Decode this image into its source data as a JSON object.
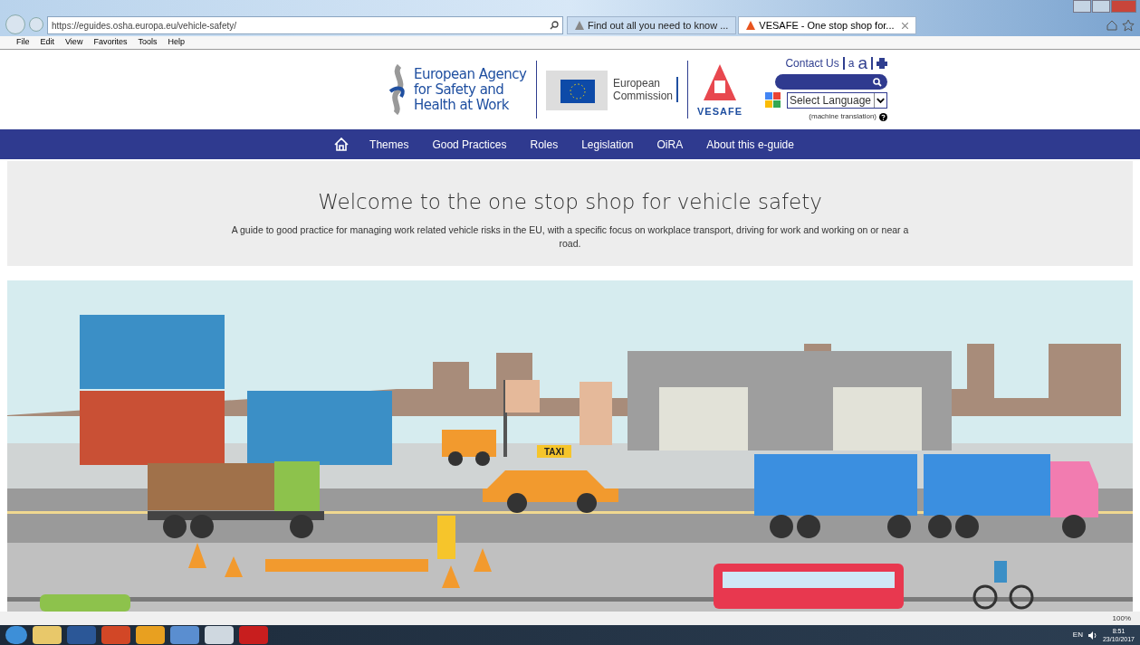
{
  "browser": {
    "url": "https://eguides.osha.europa.eu/vehicle-safety/",
    "tabs": [
      {
        "label": "Find out all you need to know ...",
        "selected": false
      },
      {
        "label": "VESAFE - One stop shop for...",
        "selected": true
      }
    ],
    "menu": [
      "File",
      "Edit",
      "View",
      "Favorites",
      "Tools",
      "Help"
    ],
    "zoom": "100%"
  },
  "header": {
    "agency": "European Agency for Safety and Health at Work",
    "commission": "European Commission",
    "vesafe": "VESAFE",
    "contact": "Contact Us",
    "font_small": "a",
    "font_large": "a",
    "language": "Select Language",
    "translation_note": "(machine translation)"
  },
  "nav": [
    "Themes",
    "Good Practices",
    "Roles",
    "Legislation",
    "OiRA",
    "About this e-guide"
  ],
  "hero": {
    "title": "Welcome to the one stop shop for vehicle safety",
    "subtitle": "A guide to good practice for managing work related vehicle risks in the EU, with a specific focus on workplace transport, driving for work and working on or near a road."
  },
  "illustration": {
    "taxi_sign": "TAXI"
  },
  "taskbar": {
    "language": "EN",
    "time": "8:51",
    "date": "23/10/2017"
  }
}
